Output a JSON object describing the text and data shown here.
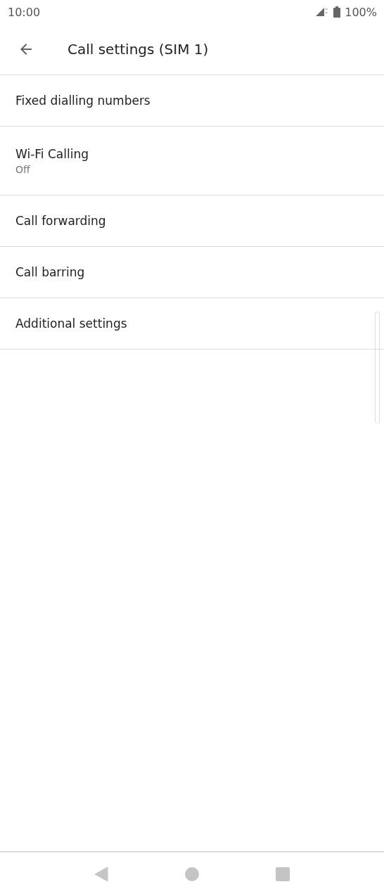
{
  "status_bar": {
    "time": "10:00",
    "battery": "100%"
  },
  "app_bar": {
    "title": "Call settings (SIM 1)"
  },
  "settings": [
    {
      "title": "Fixed dialling numbers"
    },
    {
      "title": "Wi-Fi Calling",
      "summary": "Off"
    },
    {
      "title": "Call forwarding"
    },
    {
      "title": "Call barring"
    },
    {
      "title": "Additional settings"
    }
  ]
}
